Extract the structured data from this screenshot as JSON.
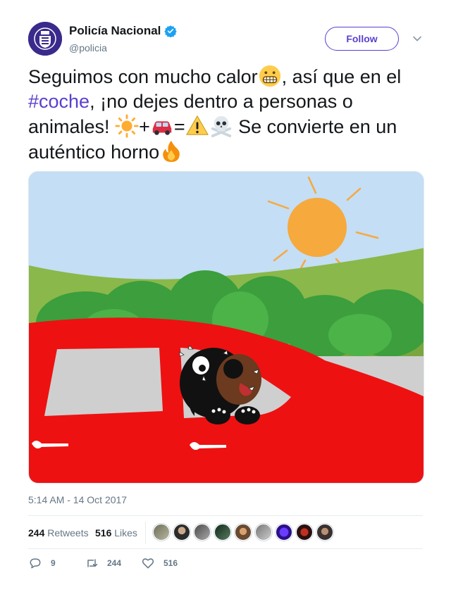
{
  "user": {
    "display_name": "Policía Nacional",
    "handle": "@policia",
    "verified": true,
    "avatar_icon": "police-badge-icon"
  },
  "follow_label": "Follow",
  "tweet": {
    "text_1": "Seguimos con mucho calor",
    "emoji_1": "grimacing-face-emoji",
    "text_2": ", así que en el ",
    "hashtag": "#coche",
    "text_3": ", ¡no dejes dentro a personas o animales! ",
    "emoji_sun": "sun-emoji",
    "plus": "+",
    "emoji_car": "car-emoji",
    "equals": "=",
    "emoji_warning": "warning-emoji",
    "emoji_skull": "skull-crossbones-emoji",
    "text_4": " Se convierte en un auténtico horno",
    "emoji_fire": "fire-emoji"
  },
  "media_description_icon": "dog-in-hot-car-illustration",
  "timestamp": "5:14 AM - 14 Oct 2017",
  "stats": {
    "retweets_count": "244",
    "retweets_label": "Retweets",
    "likes_count": "516",
    "likes_label": "Likes"
  },
  "likers_count": 9,
  "actions": {
    "reply_count": "9",
    "retweet_count": "244",
    "like_count": "516"
  },
  "colors": {
    "accent": "#5b3fcf",
    "verified": "#1da1f2",
    "muted": "#657786"
  }
}
